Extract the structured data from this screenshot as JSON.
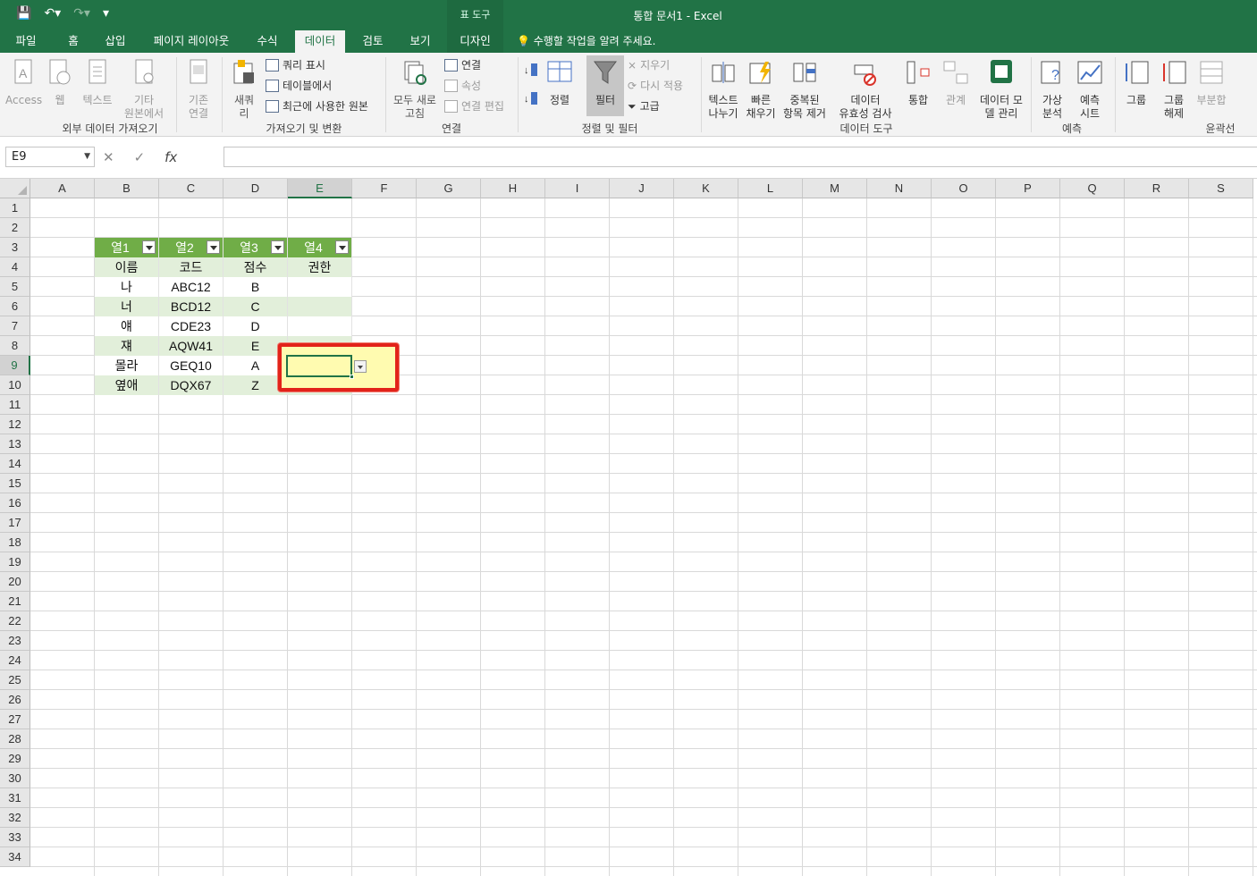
{
  "window": {
    "title": "통합 문서1 - Excel",
    "context_tab_group": "표 도구"
  },
  "qat": {
    "save": "💾",
    "undo": "↶▾",
    "redo": "↷▾",
    "customize": "▾"
  },
  "tabs": [
    "파일",
    "홈",
    "삽입",
    "페이지 레이아웃",
    "수식",
    "데이터",
    "검토",
    "보기",
    "디자인"
  ],
  "active_tab": "데이터",
  "tell_me": "수행할 작업을 알려 주세요.",
  "ribbon": {
    "groups": {
      "external": "외부 데이터 가져오기",
      "get_transform": "가져오기 및 변환",
      "connections": "연결",
      "sort_filter": "정렬 및 필터",
      "data_tools": "데이터 도구",
      "forecast": "예측",
      "outline": "윤곽선"
    },
    "buttons": {
      "access": "Access",
      "web": "웹",
      "text": "텍스트",
      "other1": "기타",
      "other2": "원본에서",
      "existing1": "기존",
      "existing2": "연결",
      "newquery1": "새쿼",
      "newquery2": "리",
      "show_query": "쿼리 표시",
      "from_table": "테이블에서",
      "recent": "최근에 사용한 원본",
      "refresh1": "모두 새로",
      "refresh2": "고침",
      "conn": "연결",
      "props": "속성",
      "edit_links": "연결 편집",
      "sort": "정렬",
      "filter": "필터",
      "clear": "지우기",
      "reapply": "다시 적용",
      "advanced": "고급",
      "text_split1": "텍스트",
      "text_split2": "나누기",
      "flash1": "빠른",
      "flash2": "채우기",
      "dup1": "중복된",
      "dup2": "항목 제거",
      "valid1": "데이터",
      "valid2": "유효성 검사",
      "consolidate": "통합",
      "relations": "관계",
      "model1": "데이터 모",
      "model2": "델 관리",
      "whatif1": "가상",
      "whatif2": "분석",
      "fsheet1": "예측",
      "fsheet2": "시트",
      "group": "그룹",
      "ungroup1": "그룹",
      "ungroup2": "해제",
      "subtotal": "부분합"
    }
  },
  "formula_bar": {
    "name_box": "E9",
    "cancel": "✕",
    "enter": "✓",
    "fx": "fx",
    "value": ""
  },
  "columns": [
    "A",
    "B",
    "C",
    "D",
    "E",
    "F",
    "G",
    "H",
    "I",
    "J",
    "K",
    "L",
    "M",
    "N",
    "O",
    "P",
    "Q",
    "R",
    "S"
  ],
  "selected_column": "E",
  "rows": [
    "1",
    "2",
    "3",
    "4",
    "5",
    "6",
    "7",
    "8",
    "9",
    "10",
    "11",
    "12",
    "13",
    "14",
    "15",
    "16",
    "17",
    "18",
    "19",
    "20",
    "21",
    "22",
    "23",
    "24",
    "25",
    "26",
    "27",
    "28",
    "29",
    "30",
    "31",
    "32",
    "33",
    "34"
  ],
  "selected_row": "9",
  "table": {
    "headers": [
      "열1",
      "열2",
      "열3",
      "열4"
    ],
    "rows": [
      [
        "이름",
        "코드",
        "점수",
        "권한"
      ],
      [
        "나",
        "ABC12",
        "B",
        ""
      ],
      [
        "너",
        "BCD12",
        "C",
        ""
      ],
      [
        "얘",
        "CDE23",
        "D",
        ""
      ],
      [
        "쟤",
        "AQW41",
        "E",
        ""
      ],
      [
        "몰라",
        "GEQ10",
        "A",
        ""
      ],
      [
        "옆애",
        "DQX67",
        "Z",
        ""
      ]
    ]
  },
  "colors": {
    "brand": "#217346",
    "table_header": "#70ad47",
    "band": "#e2efda",
    "highlight_border": "#e2231a",
    "highlight_fill": "#fffbb0"
  }
}
